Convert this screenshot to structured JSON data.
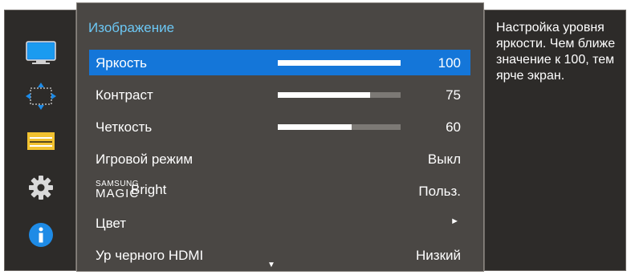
{
  "menu": {
    "title": "Изображение",
    "items": [
      {
        "label": "Яркость",
        "value": "100",
        "slider": 100,
        "selected": true
      },
      {
        "label": "Контраст",
        "value": "75",
        "slider": 75
      },
      {
        "label": "Четкость",
        "value": "60",
        "slider": 60
      },
      {
        "label": "Игровой режим",
        "value": "Выкл"
      },
      {
        "label_top": "SAMSUNG",
        "label_mid": "MAGIC",
        "label_suffix": "Bright",
        "value": "Польз."
      },
      {
        "label": "Цвет",
        "value": "►"
      },
      {
        "label": "Ур черного HDMI",
        "value": "Низкий"
      }
    ],
    "scroll_indicator": "▼"
  },
  "help": {
    "text": "Настройка уровня яркости. Чем ближе значение к 100, тем ярче экран."
  },
  "sidebar": {
    "icons": [
      "monitor-icon",
      "move-arrows-icon",
      "menu-bars-icon",
      "gear-icon",
      "info-icon"
    ]
  },
  "colors": {
    "accent": "#1476d9",
    "title": "#6cc7f4",
    "panel": "#4a4744",
    "dark": "#2d2b29"
  }
}
